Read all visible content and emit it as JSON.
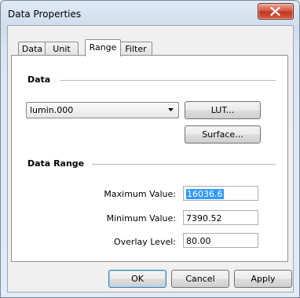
{
  "window": {
    "title": "Data Properties"
  },
  "tabs": [
    {
      "label": "Data"
    },
    {
      "label": "Unit"
    },
    {
      "label": "Range"
    },
    {
      "label": "Filter"
    }
  ],
  "data_section": {
    "heading": "Data",
    "selected_dataset": "lumin.000",
    "lut_button": "LUT...",
    "surface_button": "Surface..."
  },
  "range_section": {
    "heading": "Data Range",
    "max_label": "Maximum Value:",
    "max_value": "16036.6",
    "min_label": "Minimum Value:",
    "min_value": "7390.52",
    "overlay_label": "Overlay Level:",
    "overlay_value": "80.00"
  },
  "footer": {
    "ok": "OK",
    "cancel": "Cancel",
    "apply": "Apply"
  },
  "colors": {
    "selection": "#3399ff",
    "close_button": "#c1351f"
  }
}
